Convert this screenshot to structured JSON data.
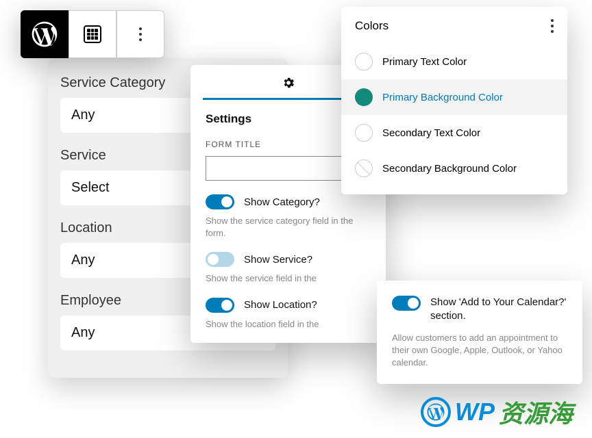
{
  "toolbar": {
    "wp": "wordpress-logo",
    "grid": "grid",
    "more": "more"
  },
  "form": {
    "fields": [
      {
        "label": "Service Category",
        "value": "Any",
        "chevron": false
      },
      {
        "label": "Service",
        "value": "Select",
        "chevron": false
      },
      {
        "label": "Location",
        "value": "Any",
        "chevron": false
      },
      {
        "label": "Employee",
        "value": "Any",
        "chevron": true
      }
    ]
  },
  "settings": {
    "title": "Settings",
    "form_title_label": "FORM TITLE",
    "form_title_value": "",
    "toggles": [
      {
        "label": "Show Category?",
        "on": true,
        "desc": "Show the service category field in the form."
      },
      {
        "label": "Show Service?",
        "on": false,
        "desc": "Show the service field in the"
      },
      {
        "label": "Show Location?",
        "on": true,
        "desc": "Show the location field in the"
      }
    ]
  },
  "colors": {
    "title": "Colors",
    "items": [
      {
        "label": "Primary Text Color",
        "swatch": "empty",
        "selected": false
      },
      {
        "label": "Primary Background Color",
        "swatch": "teal",
        "selected": true
      },
      {
        "label": "Secondary Text Color",
        "swatch": "empty",
        "selected": false
      },
      {
        "label": "Secondary Background Color",
        "swatch": "diag",
        "selected": false
      }
    ]
  },
  "calendar": {
    "label": "Show 'Add to Your Calendar?' section.",
    "on": true,
    "desc": "Allow customers to add an appointment to their own Google, Apple, Outlook, or Yahoo calendar."
  },
  "watermark": {
    "wp": "WP",
    "cn": "资源海"
  }
}
